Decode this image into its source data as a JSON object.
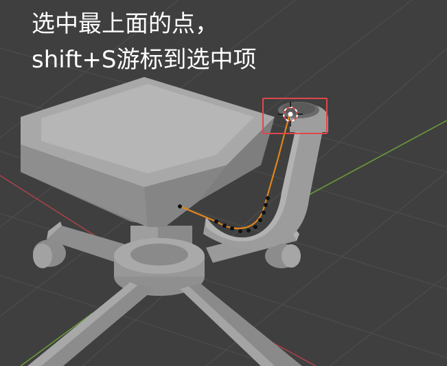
{
  "caption": {
    "line1": "选中最上面的点，",
    "line2": "shift+S游标到选中项"
  },
  "colors": {
    "background": "#3f3f3f",
    "grid": "#4a4a4a",
    "axis_x": "#b0444c",
    "axis_y": "#6a9a3a",
    "mesh": "#9a9a9a",
    "mesh_dark": "#7c7c7c",
    "mesh_light": "#b4b4b4",
    "curve": "#e08a1e",
    "vertex": "#111111",
    "selection_frame": "#e0474c",
    "cursor_red": "#e0474c"
  },
  "icons": [
    "3d-cursor-icon"
  ]
}
